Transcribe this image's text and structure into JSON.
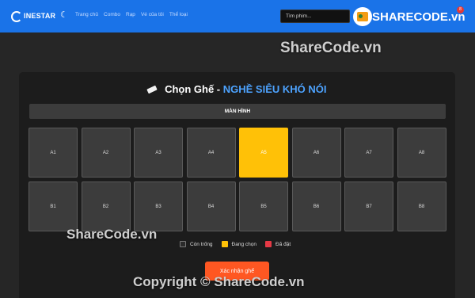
{
  "header": {
    "logo_text": "INESTAR",
    "nav_items": [
      "Trang chủ",
      "Combo",
      "Rạp",
      "Vé của tôi",
      "Thể loại"
    ],
    "search_placeholder": "Tìm phim...",
    "brand_text": "SHARECODE.vn",
    "notification_count": "8",
    "colors": {
      "navbar": "#1a73e8"
    }
  },
  "watermarks": {
    "top": "ShareCode.vn",
    "middle": "ShareCode.vn",
    "bottom": "Copyright © ShareCode.vn"
  },
  "booking": {
    "title_label": "Chọn Ghế -",
    "movie_name": "NGHỀ SIÊU KHÓ NÓI",
    "screen_label": "MÀN HÌNH",
    "seat_rows": [
      [
        {
          "label": "A1",
          "status": "empty"
        },
        {
          "label": "A2",
          "status": "empty"
        },
        {
          "label": "A3",
          "status": "empty"
        },
        {
          "label": "A4",
          "status": "empty"
        },
        {
          "label": "A5",
          "status": "selecting"
        },
        {
          "label": "A6",
          "status": "empty"
        },
        {
          "label": "A7",
          "status": "empty"
        },
        {
          "label": "A8",
          "status": "empty"
        }
      ],
      [
        {
          "label": "B1",
          "status": "empty"
        },
        {
          "label": "B2",
          "status": "empty"
        },
        {
          "label": "B3",
          "status": "empty"
        },
        {
          "label": "B4",
          "status": "empty"
        },
        {
          "label": "B5",
          "status": "empty"
        },
        {
          "label": "B6",
          "status": "empty"
        },
        {
          "label": "B7",
          "status": "empty"
        },
        {
          "label": "B8",
          "status": "empty"
        }
      ]
    ],
    "legend": {
      "empty": "Còn trống",
      "selecting": "Đang chọn",
      "booked": "Đã đặt"
    },
    "confirm_label": "Xác nhận ghế",
    "colors": {
      "seat_empty": "#3c3c3c",
      "seat_selecting": "#ffc107",
      "seat_booked": "#e53945",
      "confirm_button": "#ff5722",
      "movie_name": "#4da3ff"
    }
  }
}
